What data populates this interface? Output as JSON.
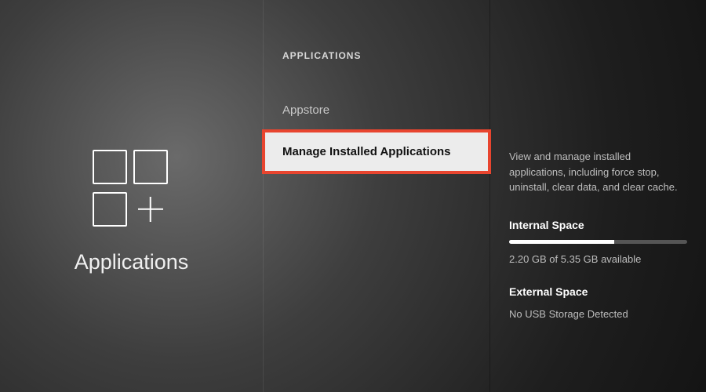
{
  "left": {
    "title": "Applications"
  },
  "header": "APPLICATIONS",
  "menu": {
    "items": [
      {
        "label": "Appstore",
        "selected": false
      },
      {
        "label": "Manage Installed Applications",
        "selected": true
      }
    ]
  },
  "detail": {
    "description": "View and manage installed applications, including force stop, uninstall, clear data, and clear cache.",
    "internal": {
      "title": "Internal Space",
      "used_gb": 2.2,
      "total_gb": 5.35,
      "fill_percent": 59,
      "text": "2.20 GB of 5.35 GB available"
    },
    "external": {
      "title": "External Space",
      "status": "No USB Storage Detected"
    }
  }
}
